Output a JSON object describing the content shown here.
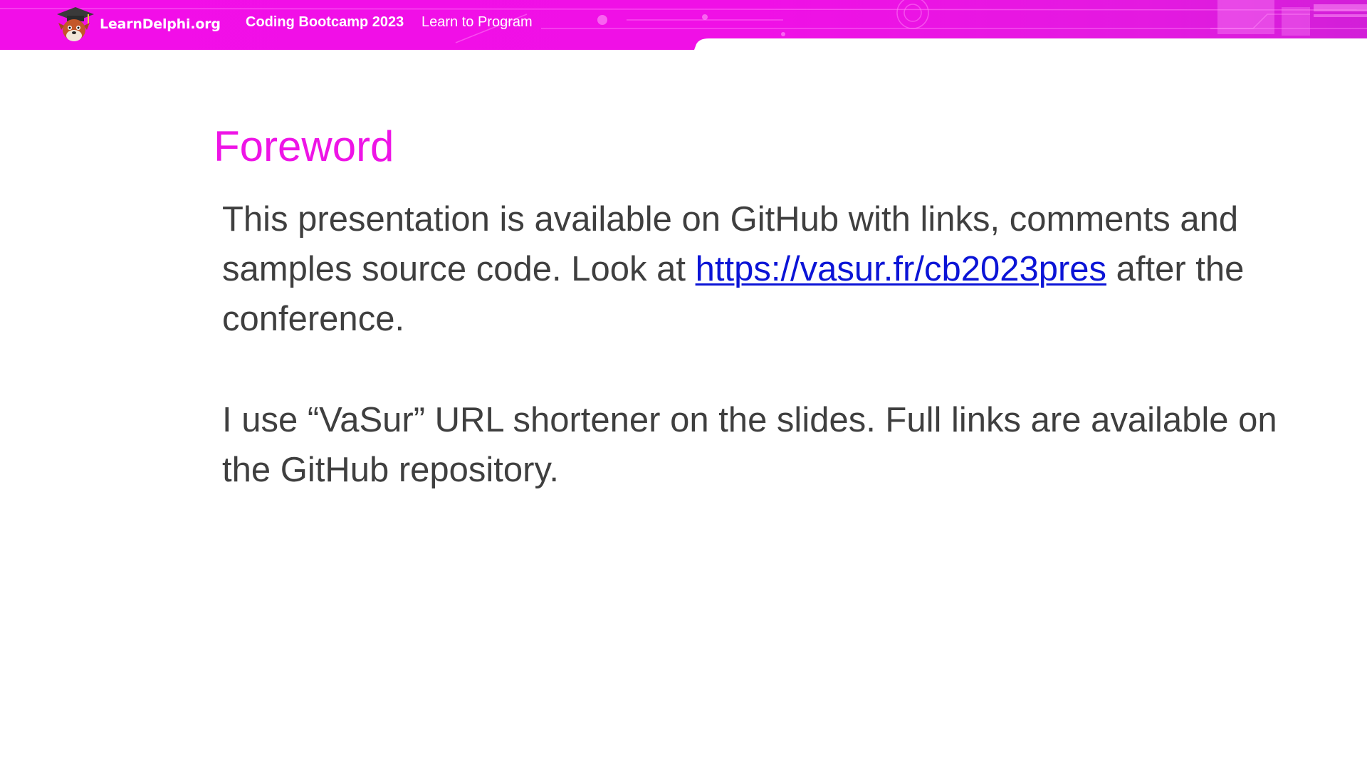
{
  "header": {
    "logo_text": "LearnDelphi.org",
    "event_title": "Coding Bootcamp 2023",
    "event_subtitle": "Learn to Program",
    "banner_color": "#f20ee8"
  },
  "slide": {
    "title": "Foreword",
    "title_color": "#ee14e6",
    "paragraph1": {
      "before_link": "This presentation is available on GitHub with links, comments and samples source code. Look at ",
      "link_text": "https://vasur.fr/cb2023pres",
      "after_link": " after the conference."
    },
    "paragraph2": "I use “VaSur” URL shortener on the slides. Full links are available on the GitHub repository.",
    "text_color": "#3f3f3f",
    "link_color": "#0b14d6"
  }
}
